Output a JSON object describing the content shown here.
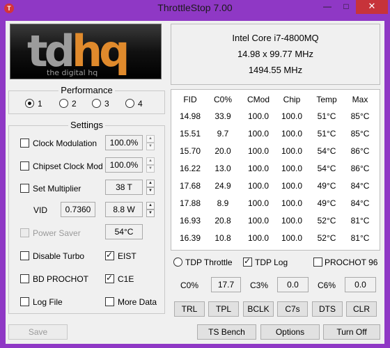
{
  "window": {
    "title": "ThrottleStop 7.00",
    "icon_letter": "T",
    "min_glyph": "—",
    "max_glyph": "□",
    "close_glyph": "✕"
  },
  "logo": {
    "main_text": "tdhq",
    "sub_text": "the digital hq"
  },
  "cpu": {
    "name": "Intel Core i7-4800MQ",
    "multiplier_line": "14.98 x 99.77 MHz",
    "speed": "1494.55 MHz"
  },
  "performance": {
    "title": "Performance",
    "options": [
      {
        "label": "1",
        "checked": true
      },
      {
        "label": "2",
        "checked": false
      },
      {
        "label": "3",
        "checked": false
      },
      {
        "label": "4",
        "checked": false
      }
    ]
  },
  "settings": {
    "title": "Settings",
    "clock_modulation": {
      "label": "Clock Modulation",
      "value": "100.0%"
    },
    "chipset_clock_mod": {
      "label": "Chipset Clock Mod",
      "value": "100.0%"
    },
    "set_multiplier": {
      "label": "Set Multiplier",
      "value": "38 T"
    },
    "vid": {
      "label": "VID",
      "value": "0.7360",
      "power": "8.8 W"
    },
    "power_saver": {
      "label": "Power Saver",
      "value": "54°C"
    },
    "disable_turbo": "Disable Turbo",
    "eist": "EIST",
    "bd_prochot": "BD PROCHOT",
    "c1e": "C1E",
    "log_file": "Log File",
    "more_data": "More Data"
  },
  "table": {
    "headers": [
      "FID",
      "C0%",
      "CMod",
      "Chip",
      "Temp",
      "Max"
    ],
    "rows": [
      [
        "14.98",
        "33.9",
        "100.0",
        "100.0",
        "51°C",
        "85°C"
      ],
      [
        "15.51",
        "9.7",
        "100.0",
        "100.0",
        "51°C",
        "85°C"
      ],
      [
        "15.70",
        "20.0",
        "100.0",
        "100.0",
        "54°C",
        "86°C"
      ],
      [
        "16.22",
        "13.0",
        "100.0",
        "100.0",
        "54°C",
        "86°C"
      ],
      [
        "17.68",
        "24.9",
        "100.0",
        "100.0",
        "49°C",
        "84°C"
      ],
      [
        "17.88",
        "8.9",
        "100.0",
        "100.0",
        "49°C",
        "84°C"
      ],
      [
        "16.93",
        "20.8",
        "100.0",
        "100.0",
        "52°C",
        "81°C"
      ],
      [
        "16.39",
        "10.8",
        "100.0",
        "100.0",
        "52°C",
        "81°C"
      ]
    ]
  },
  "options_row": {
    "tdp_throttle": "TDP Throttle",
    "tdp_log": "TDP Log",
    "prochot": "PROCHOT 96"
  },
  "cstates": [
    {
      "label": "C0%",
      "value": "17.7"
    },
    {
      "label": "C3%",
      "value": "0.0"
    },
    {
      "label": "C6%",
      "value": "0.0"
    }
  ],
  "tool_buttons": [
    "TRL",
    "TPL",
    "BCLK",
    "C7s",
    "DTS",
    "CLR"
  ],
  "bottom_buttons": {
    "save": "Save",
    "ts_bench": "TS Bench",
    "options": "Options",
    "turn_off": "Turn Off"
  },
  "colors": {
    "title_bar": "#8f38c5",
    "close_button": "#c7333a",
    "logo_orange": "#e08a2c",
    "dialog_bg": "#f0f0f0"
  }
}
